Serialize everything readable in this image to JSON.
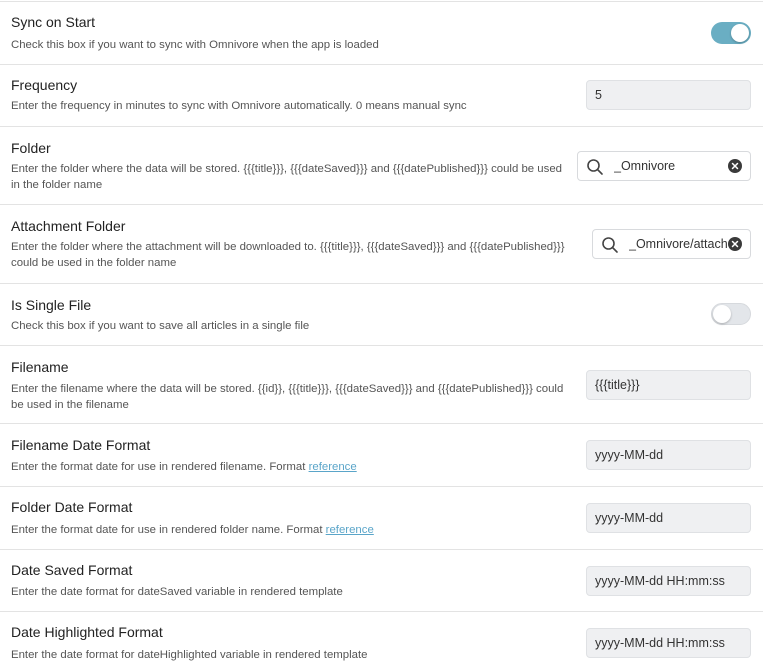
{
  "settings": [
    {
      "key": "sync_on_start",
      "name": "Sync on Start",
      "desc": "Check this box if you want to sync with Omnivore when the app is loaded",
      "control": "toggle",
      "enabled": true
    },
    {
      "key": "frequency",
      "name": "Frequency",
      "desc": "Enter the frequency in minutes to sync with Omnivore automatically. 0 means manual sync",
      "control": "text",
      "value": "5"
    },
    {
      "key": "folder",
      "name": "Folder",
      "desc": "Enter the folder where the data will be stored. {{{title}}}, {{{dateSaved}}} and {{{datePublished}}} could be used in the folder name",
      "control": "search",
      "value": "_Omnivore"
    },
    {
      "key": "attachment_folder",
      "name": "Attachment Folder",
      "desc": "Enter the folder where the attachment will be downloaded to. {{{title}}}, {{{dateSaved}}} and {{{datePublished}}} could be used in the folder name",
      "control": "search",
      "value": "_Omnivore/attachments"
    },
    {
      "key": "is_single_file",
      "name": "Is Single File",
      "desc": "Check this box if you want to save all articles in a single file",
      "control": "toggle",
      "enabled": false
    },
    {
      "key": "filename",
      "name": "Filename",
      "desc": "Enter the filename where the data will be stored. {{id}}, {{{title}}}, {{{dateSaved}}} and {{{datePublished}}} could be used in the filename",
      "control": "text",
      "value": "{{{title}}}"
    },
    {
      "key": "filename_date_format",
      "name": "Filename Date Format",
      "desc": "Enter the format date for use in rendered filename. Format ",
      "link": "reference",
      "control": "text",
      "value": "yyyy-MM-dd"
    },
    {
      "key": "folder_date_format",
      "name": "Folder Date Format",
      "desc": "Enter the format date for use in rendered folder name. Format ",
      "link": "reference",
      "control": "text",
      "value": "yyyy-MM-dd"
    },
    {
      "key": "date_saved_format",
      "name": "Date Saved Format",
      "desc": "Enter the date format for dateSaved variable in rendered template",
      "control": "text",
      "value": "yyyy-MM-dd HH:mm:ss"
    },
    {
      "key": "date_highlighted_format",
      "name": "Date Highlighted Format",
      "desc": "Enter the date format for dateHighlighted variable in rendered template",
      "control": "text",
      "value": "yyyy-MM-dd HH:mm:ss"
    }
  ],
  "icons": {
    "search": "search-icon",
    "clear": "clear-icon"
  },
  "colors": {
    "toggle_on": "#6aaec3",
    "toggle_off": "#e3e6ea",
    "link": "#5aa5c9",
    "input_bg": "#eff0f2",
    "divider": "#e3e3e3"
  }
}
